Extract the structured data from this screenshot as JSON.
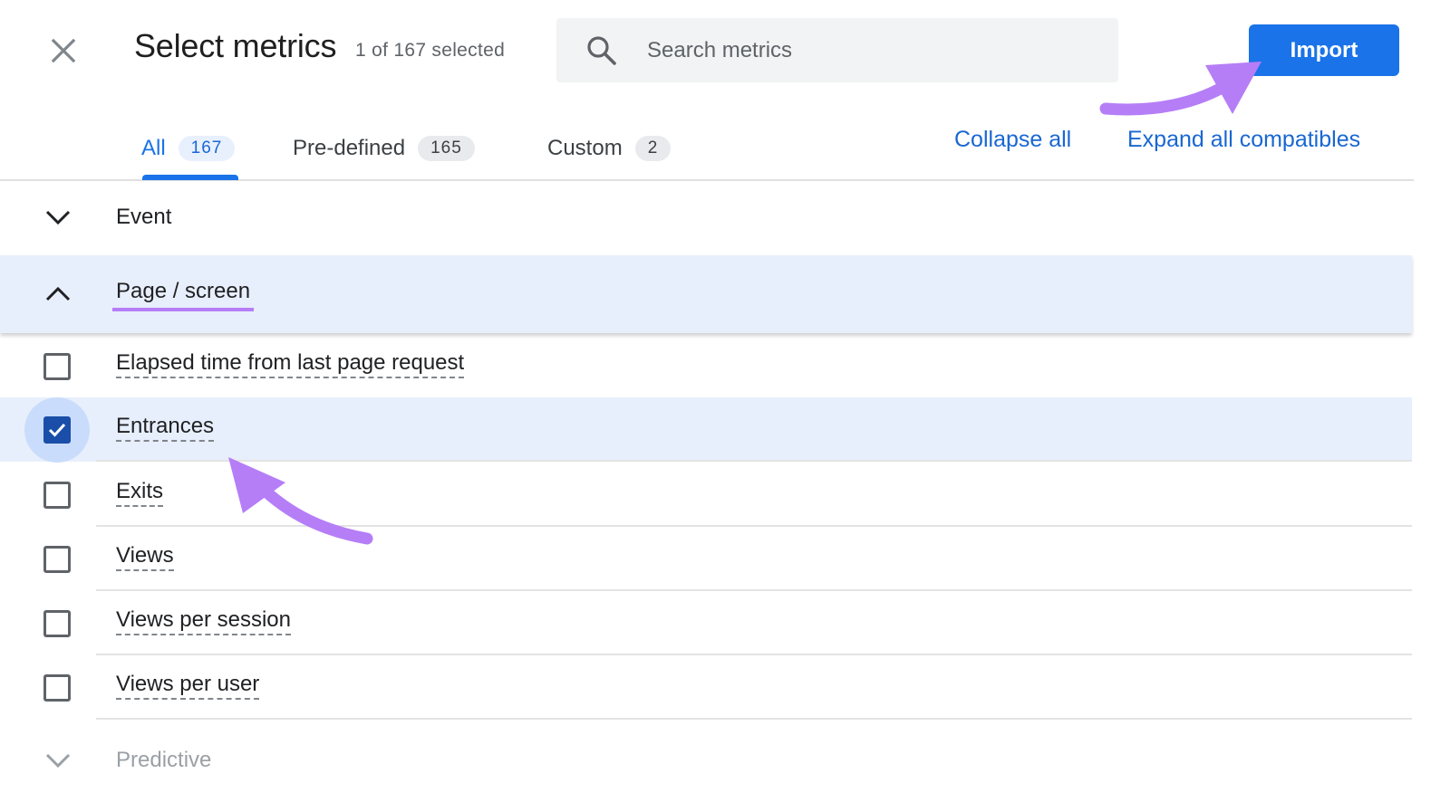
{
  "header": {
    "close_icon": "close-icon",
    "title": "Select metrics",
    "selection_status": "1 of 167 selected",
    "search": {
      "placeholder": "Search metrics",
      "value": "",
      "icon": "search-icon"
    },
    "import_label": "Import"
  },
  "tabs": [
    {
      "label": "All",
      "count": "167",
      "active": true
    },
    {
      "label": "Pre-defined",
      "count": "165",
      "active": false
    },
    {
      "label": "Custom",
      "count": "2",
      "active": false
    }
  ],
  "actions": {
    "collapse_all": "Collapse all",
    "expand_all": "Expand all compatibles"
  },
  "groups": {
    "event": {
      "label": "Event",
      "expanded": false
    },
    "page_screen": {
      "label": "Page / screen",
      "expanded": true
    },
    "predictive": {
      "label": "Predictive",
      "expanded": false
    }
  },
  "metrics": [
    {
      "label": "Elapsed time from last page request",
      "checked": false
    },
    {
      "label": "Entrances",
      "checked": true
    },
    {
      "label": "Exits",
      "checked": false
    },
    {
      "label": "Views",
      "checked": false
    },
    {
      "label": "Views per session",
      "checked": false
    },
    {
      "label": "Views per user",
      "checked": false
    }
  ],
  "colors": {
    "accent": "#1a73e8",
    "link": "#1967d2",
    "selected_row": "#e8effc",
    "checkbox_checked": "#1a4ea8",
    "annotation": "#b57ef7"
  }
}
